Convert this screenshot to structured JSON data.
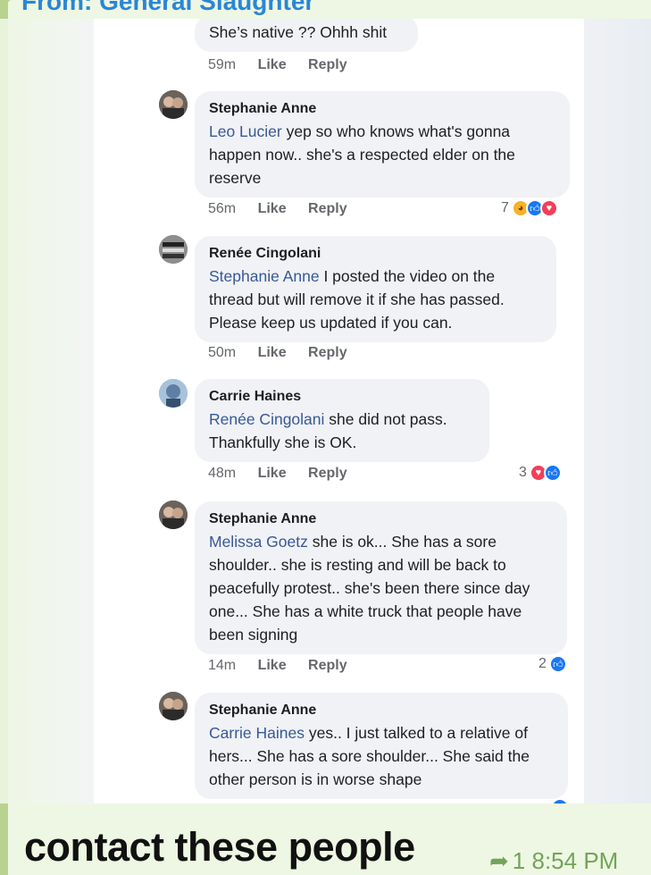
{
  "header": {
    "forwarded_from": "From: General Slaughter"
  },
  "comments": [
    {
      "name": "",
      "mention": "",
      "text": "She’s native ?? Ohhh shit",
      "time": "59m",
      "like": "Like",
      "reply": "Reply",
      "reaction_count": "",
      "reactions": []
    },
    {
      "name": "Stephanie Anne",
      "mention": "Leo Lucier",
      "text": " yep so who knows what's gonna happen now.. she's a respected elder on the reserve",
      "time": "56m",
      "like": "Like",
      "reply": "Reply",
      "reaction_count": "7",
      "reactions": [
        "sad",
        "like",
        "love"
      ]
    },
    {
      "name": "Renée Cingolani",
      "mention": "Stephanie Anne",
      "text": " I posted the video on the thread but will remove it if she has passed. Please keep us updated if you can.",
      "time": "50m",
      "like": "Like",
      "reply": "Reply",
      "reaction_count": "",
      "reactions": []
    },
    {
      "name": "Carrie Haines",
      "mention": "Renée Cingolani",
      "text": " she did not pass. Thankfully she is OK.",
      "time": "48m",
      "like": "Like",
      "reply": "Reply",
      "reaction_count": "3",
      "reactions": [
        "love",
        "like"
      ]
    },
    {
      "name": "Stephanie Anne",
      "mention": "Melissa Goetz",
      "text": " she is ok... She has a sore shoulder.. she is resting and will be back to peacefully protest.. she's been there since day one... She has a white truck that people have been signing",
      "time": "14m",
      "like": "Like",
      "reply": "Reply",
      "reaction_count": "2",
      "reactions": [
        "like"
      ]
    },
    {
      "name": "Stephanie Anne",
      "mention": "Carrie Haines",
      "text": " yes.. I just talked to a relative of hers... She has a sore shoulder... She said the other person is in worse shape",
      "time": "",
      "like": "",
      "reply": "",
      "reaction_count": "",
      "reactions": []
    }
  ],
  "message": {
    "caption": "contact these people",
    "reply_count": "1",
    "time": "8:54 PM"
  },
  "colors": {
    "bubble_bg": "#eef7e3",
    "link_blue": "#385898",
    "header_blue": "#2a86d6",
    "meta_green": "#74a35a"
  }
}
